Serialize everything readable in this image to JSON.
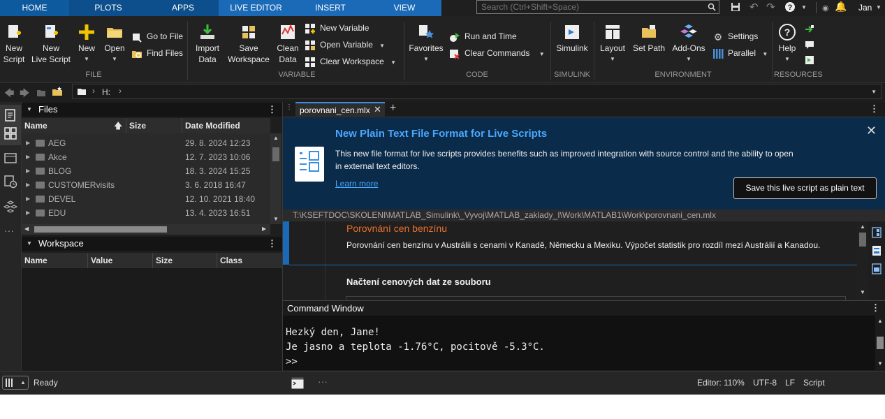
{
  "tabs": [
    "HOME",
    "PLOTS",
    "APPS",
    "LIVE EDITOR",
    "INSERT",
    "VIEW"
  ],
  "search": {
    "placeholder": "Search (Ctrl+Shift+Space)"
  },
  "user": "Jan",
  "toolstrip": {
    "file": {
      "section": "FILE",
      "new_script": [
        "New",
        "Script"
      ],
      "new_live_script": [
        "New",
        "Live Script"
      ],
      "new": "New",
      "open": "Open",
      "go_to_file": "Go to File",
      "find_files": "Find Files"
    },
    "variable": {
      "section": "VARIABLE",
      "import_data": [
        "Import",
        "Data"
      ],
      "save_workspace": [
        "Save",
        "Workspace"
      ],
      "clean_data": [
        "Clean",
        "Data"
      ],
      "new_variable": "New Variable",
      "open_variable": "Open Variable",
      "clear_workspace": "Clear Workspace"
    },
    "code": {
      "section": "CODE",
      "favorites": "Favorites",
      "run_and_time": "Run and Time",
      "clear_commands": "Clear Commands"
    },
    "simulink": {
      "section": "SIMULINK",
      "simulink": "Simulink"
    },
    "environment": {
      "section": "ENVIRONMENT",
      "layout": "Layout",
      "set_path": "Set Path",
      "add_ons": "Add-Ons",
      "settings": "Settings",
      "parallel": "Parallel"
    },
    "resources": {
      "section": "RESOURCES",
      "help": "Help"
    }
  },
  "address": {
    "path": "H:"
  },
  "files_panel": {
    "title": "Files",
    "columns": [
      "Name",
      "Size",
      "Date Modified"
    ],
    "rows": [
      {
        "name": "AEG",
        "date": "29. 8. 2024 12:23"
      },
      {
        "name": "Akce",
        "date": "12. 7. 2023 10:06"
      },
      {
        "name": "BLOG",
        "date": "18. 3. 2024 15:25"
      },
      {
        "name": "CUSTOMERvisits",
        "date": "3. 6. 2018 16:47"
      },
      {
        "name": "DEVEL",
        "date": "12. 10. 2021 18:40"
      },
      {
        "name": "EDU",
        "date": "13. 4. 2023 16:51"
      }
    ]
  },
  "workspace_panel": {
    "title": "Workspace",
    "columns": [
      "Name",
      "Value",
      "Size",
      "Class"
    ]
  },
  "editor": {
    "tab": "porovnani_cen.mlx",
    "banner": {
      "title": "New Plain Text File Format for Live Scripts",
      "body": "This new file format for live scripts provides benefits such as improved integration with source control and the ability to open in external text editors.",
      "link": "Learn more",
      "button": "Save this live script as plain text"
    },
    "path": "T:\\KSEFTDOC\\SKOLENI\\MATLAB_Simulink\\_Vyvoj\\MATLAB_zaklady_I\\Work\\MATLAB1\\Work\\porovnani_cen.mlx",
    "section_title": "Porovnání cen benzínu",
    "section_text": "Porovnání cen benzínu v Austrálii s cenami v Kanadě, Německu a Mexiku. Výpočet statistik pro rozdíl mezi Austrálií a Kanadou.",
    "section2_title": "Načtení cenových dat ze souboru"
  },
  "command_window": {
    "title": "Command Window",
    "lines": [
      "Hezký den, Jane!",
      "Je jasno a teplota -1.76°C, pocitově -5.3°C."
    ],
    "prompt": ">>"
  },
  "status": {
    "ready": "Ready",
    "editor_zoom": "Editor: 110%",
    "encoding": "UTF-8",
    "line_ending": "LF",
    "mode": "Script"
  },
  "colors": {
    "accent": "#0e5a9e",
    "banner_bg": "#0b2b4a",
    "banner_title": "#4aa8ff",
    "section_title": "#e8702a"
  }
}
